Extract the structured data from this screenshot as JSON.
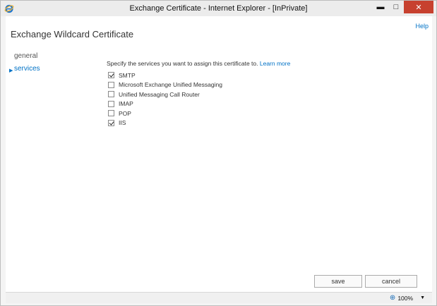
{
  "window": {
    "title": "Exchange Certificate - Internet Explorer - [InPrivate]",
    "controls": {
      "minimize": "▬",
      "maximize": "□",
      "close": "✕"
    }
  },
  "header": {
    "help_label": "Help",
    "page_title": "Exchange Wildcard Certificate"
  },
  "nav": {
    "items": [
      {
        "label": "general",
        "selected": false
      },
      {
        "label": "services",
        "selected": true
      }
    ]
  },
  "main": {
    "instruction": "Specify the services you want to assign this certificate to.",
    "learn_more": "Learn more",
    "services": [
      {
        "label": "SMTP",
        "checked": true
      },
      {
        "label": "Microsoft Exchange Unified Messaging",
        "checked": false
      },
      {
        "label": "Unified Messaging Call Router",
        "checked": false
      },
      {
        "label": "IMAP",
        "checked": false
      },
      {
        "label": "POP",
        "checked": false
      },
      {
        "label": "IIS",
        "checked": true
      }
    ]
  },
  "footer": {
    "save_label": "save",
    "cancel_label": "cancel"
  },
  "statusbar": {
    "zoom": "100%"
  },
  "colors": {
    "accent": "#0072c6",
    "close_button": "#c7412f"
  }
}
